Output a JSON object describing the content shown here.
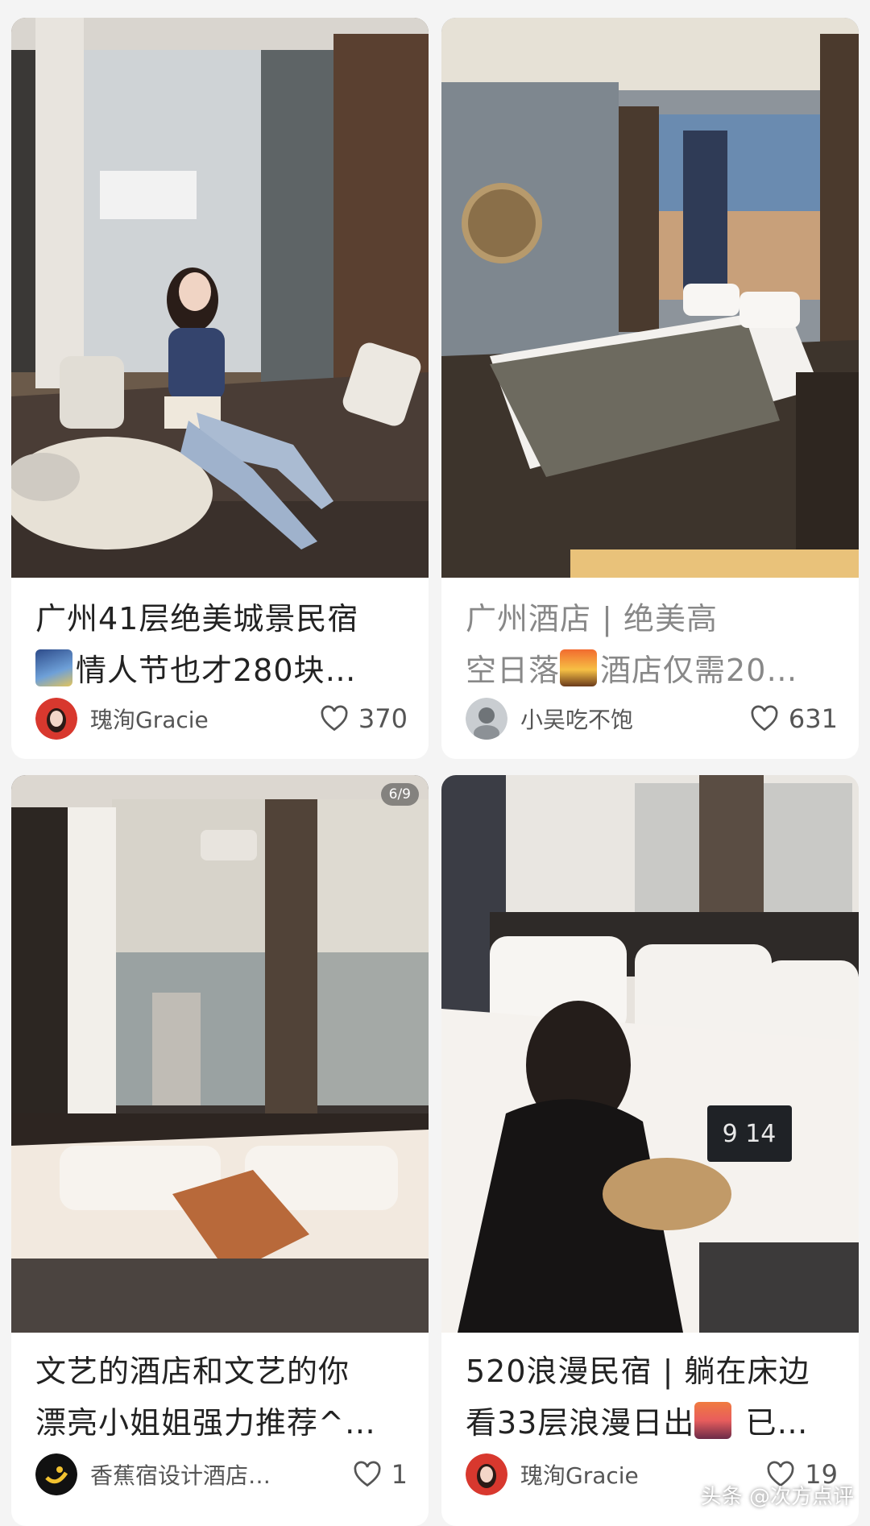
{
  "cards": [
    {
      "title_line1": "广州41层绝美城景民宿",
      "title_line2": "情人节也才280块…",
      "author": "瑰洵Gracie",
      "likes": "370",
      "emoji_icon": "night-city-emoji"
    },
    {
      "title_line1": "广州酒店 | 绝美高",
      "title_line2_a": "空日落",
      "title_line2_b": "酒店仅需20…",
      "author": "小吴吃不饱",
      "likes": "631",
      "emoji_icon": "sunset-emoji"
    },
    {
      "title_line1": "文艺的酒店和文艺的你",
      "title_line2": "漂亮小姐姐强力推荐^…",
      "author": "香蕉宿设计酒店…",
      "likes": "1",
      "image_counter": "6/9"
    },
    {
      "title_line1": "520浪漫民宿 | 躺在床边",
      "title_line2_a": "看33层浪漫日出",
      "title_line2_b": " 已…",
      "author": "瑰洵Gracie",
      "likes": "19",
      "emoji_icon": "city-sunrise-emoji",
      "clock_text": "9 14"
    }
  ],
  "watermark": "头条 @次方点评"
}
